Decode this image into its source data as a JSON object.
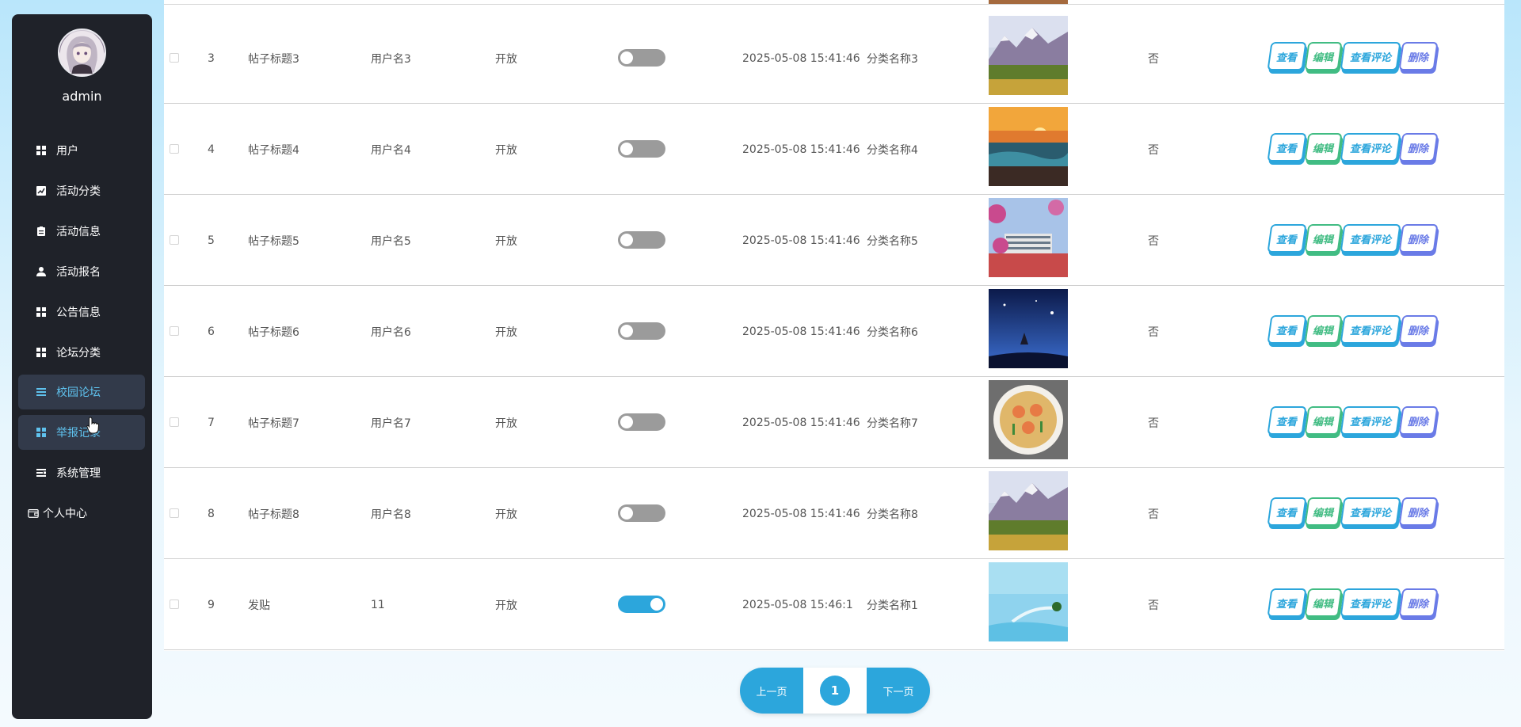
{
  "sidebar": {
    "username": "admin",
    "items": [
      {
        "label": "用户",
        "icon": "grid-icon",
        "active": false
      },
      {
        "label": "活动分类",
        "icon": "chart-icon",
        "active": false
      },
      {
        "label": "活动信息",
        "icon": "clipboard-icon",
        "active": false
      },
      {
        "label": "活动报名",
        "icon": "person-icon",
        "active": false
      },
      {
        "label": "公告信息",
        "icon": "grid-icon",
        "active": false
      },
      {
        "label": "论坛分类",
        "icon": "grid-icon",
        "active": false
      },
      {
        "label": "校园论坛",
        "icon": "list-icon",
        "active": true
      },
      {
        "label": "举报记录",
        "icon": "grid-icon",
        "active": true
      },
      {
        "label": "系统管理",
        "icon": "sliders-icon",
        "active": false
      },
      {
        "label": "个人中心",
        "icon": "wallet-icon",
        "active": false
      }
    ]
  },
  "table": {
    "actions": {
      "view": "查看",
      "edit": "编辑",
      "comment": "查看评论",
      "delete": "删除"
    },
    "rows": [
      {
        "id": "3",
        "title": "帖子标题3",
        "user": "用户名3",
        "status": "开放",
        "toggle_on": false,
        "time": "2025-05-08 15:41:46",
        "category": "分类名称3",
        "image": "mountain",
        "flag": "否"
      },
      {
        "id": "4",
        "title": "帖子标题4",
        "user": "用户名4",
        "status": "开放",
        "toggle_on": false,
        "time": "2025-05-08 15:41:46",
        "category": "分类名称4",
        "image": "sunset",
        "flag": "否"
      },
      {
        "id": "5",
        "title": "帖子标题5",
        "user": "用户名5",
        "status": "开放",
        "toggle_on": false,
        "time": "2025-05-08 15:41:46",
        "category": "分类名称5",
        "image": "campus",
        "flag": "否"
      },
      {
        "id": "6",
        "title": "帖子标题6",
        "user": "用户名6",
        "status": "开放",
        "toggle_on": false,
        "time": "2025-05-08 15:41:46",
        "category": "分类名称6",
        "image": "night",
        "flag": "否"
      },
      {
        "id": "7",
        "title": "帖子标题7",
        "user": "用户名7",
        "status": "开放",
        "toggle_on": false,
        "time": "2025-05-08 15:41:46",
        "category": "分类名称7",
        "image": "food",
        "flag": "否"
      },
      {
        "id": "8",
        "title": "帖子标题8",
        "user": "用户名8",
        "status": "开放",
        "toggle_on": false,
        "time": "2025-05-08 15:41:46",
        "category": "分类名称8",
        "image": "mountain",
        "flag": "否"
      },
      {
        "id": "9",
        "title": "发贴",
        "user": "11",
        "status": "开放",
        "toggle_on": true,
        "time": "2025-05-08 15:46:1",
        "category": "分类名称1",
        "image": "sea",
        "flag": "否"
      }
    ]
  },
  "pagination": {
    "prev": "上一页",
    "current": "1",
    "next": "下一页"
  },
  "colors": {
    "accent": "#2ca6dc",
    "edit": "#41bc83",
    "delete": "#6a7be7",
    "sidebar_bg": "#1f2229",
    "active_text": "#5fc2ee"
  }
}
